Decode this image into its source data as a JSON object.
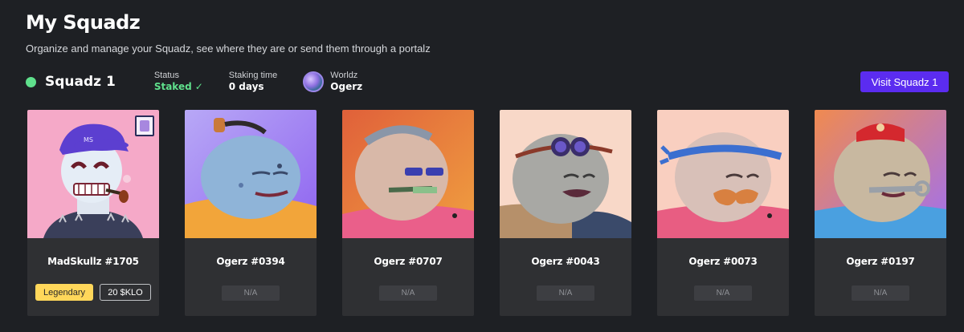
{
  "header": {
    "title": "My Squadz",
    "subtitle": "Organize and manage your Squadz, see where they are or send them through a portalz"
  },
  "squad": {
    "name": "Squadz 1",
    "status_label": "Status",
    "status_value": "Staked",
    "staking_label": "Staking time",
    "staking_value": "0 days",
    "worldz_label": "Worldz",
    "worldz_value": "Ogerz",
    "visit_button": "Visit Squadz 1"
  },
  "cards": [
    {
      "name": "MadSkullz #1705",
      "rarity": "Legendary",
      "reward": "20 $KLO"
    },
    {
      "name": "Ogerz #0394",
      "reward": "N/A"
    },
    {
      "name": "Ogerz #0707",
      "reward": "N/A"
    },
    {
      "name": "Ogerz #0043",
      "reward": "N/A"
    },
    {
      "name": "Ogerz #0073",
      "reward": "N/A"
    },
    {
      "name": "Ogerz #0197",
      "reward": "N/A"
    }
  ],
  "colors": {
    "background": "#1e2024",
    "card": "#2f3033",
    "accent_button": "#5b2cf0",
    "staked_green": "#5fe08c",
    "legendary_yellow": "#ffd75a"
  }
}
